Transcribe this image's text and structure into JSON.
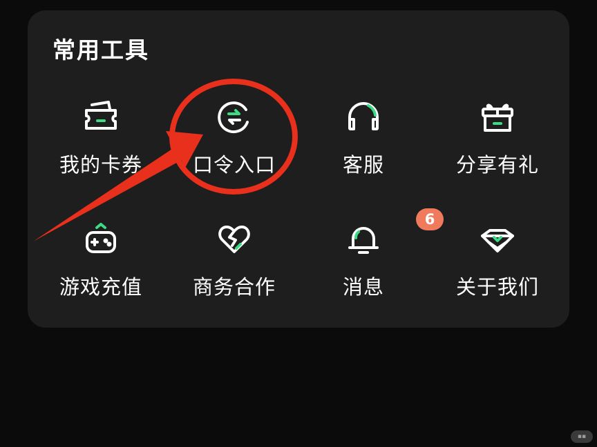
{
  "section": {
    "title": "常用工具"
  },
  "tools": [
    {
      "label": "我的卡券",
      "icon": "ticket-icon"
    },
    {
      "label": "口令入口",
      "icon": "password-exchange-icon"
    },
    {
      "label": "客服",
      "icon": "headset-icon"
    },
    {
      "label": "分享有礼",
      "icon": "gift-icon"
    },
    {
      "label": "游戏充值",
      "icon": "gamepad-icon"
    },
    {
      "label": "商务合作",
      "icon": "heart-handshake-icon"
    },
    {
      "label": "消息",
      "icon": "bell-icon",
      "badge": "6"
    },
    {
      "label": "关于我们",
      "icon": "about-badge-icon"
    }
  ],
  "colors": {
    "background": "#0b0b0b",
    "card": "#1e1e1e",
    "icon_stroke": "#ffffff",
    "accent_green": "#3ddc84",
    "badge": "#f07a5c",
    "annotation_red": "#e8301c"
  }
}
